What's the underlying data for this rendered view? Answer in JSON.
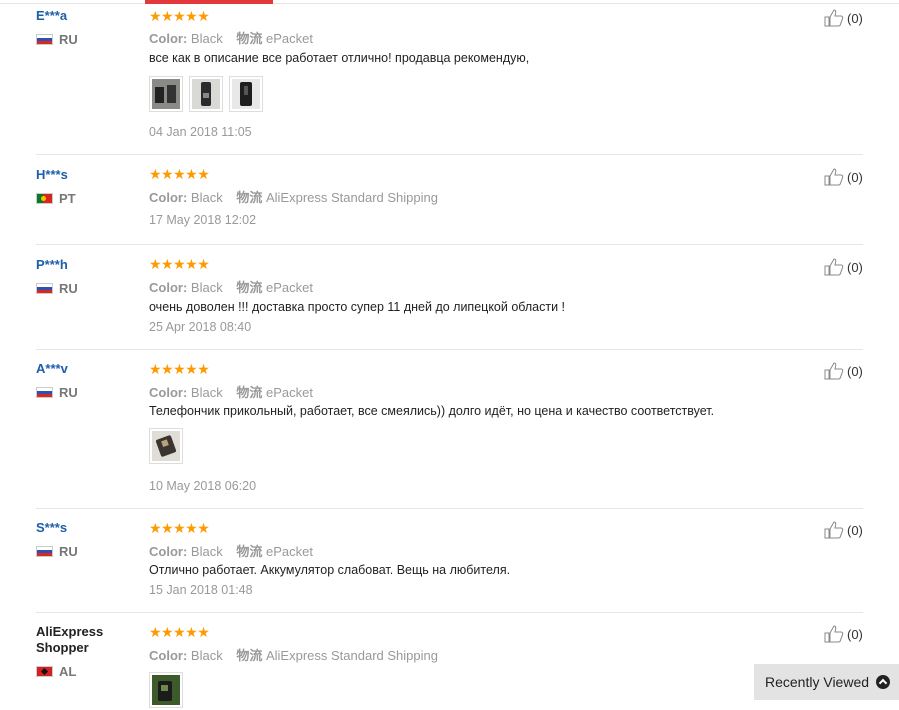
{
  "labels": {
    "color_label": "Color:",
    "shipping_label": "物流",
    "rating_stars": "★★★★★"
  },
  "reviews": [
    {
      "user": "E***a",
      "country": "RU",
      "color": "Black",
      "shipping": "ePacket",
      "text": "все как в описание все работает отлично! продавца рекомендую,",
      "photos": 3,
      "date": "04 Jan 2018 11:05",
      "helpful": "(0)"
    },
    {
      "user": "H***s",
      "country": "PT",
      "color": "Black",
      "shipping": "AliExpress Standard Shipping",
      "text": "",
      "photos": 0,
      "date": "17 May 2018 12:02",
      "helpful": "(0)"
    },
    {
      "user": "P***h",
      "country": "RU",
      "color": "Black",
      "shipping": "ePacket",
      "text": "очень доволен !!! доставка просто супер 11 дней до липецкой области !",
      "photos": 0,
      "date": "25 Apr 2018 08:40",
      "helpful": "(0)"
    },
    {
      "user": "A***v",
      "country": "RU",
      "color": "Black",
      "shipping": "ePacket",
      "text": "Телефончик прикольный, работает, все смеялись)) долго идёт, но цена и качество соответствует.",
      "photos": 1,
      "date": "10 May 2018 06:20",
      "helpful": "(0)"
    },
    {
      "user": "S***s",
      "country": "RU",
      "color": "Black",
      "shipping": "ePacket",
      "text": "Отлично работает. Аккумулятор слабоват. Вещь на любителя.",
      "photos": 0,
      "date": "15 Jan 2018 01:48",
      "helpful": "(0)"
    },
    {
      "user": "AliExpress Shopper",
      "country": "AL",
      "color": "Black",
      "shipping": "AliExpress Standard Shipping",
      "text": "",
      "photos": 1,
      "date": "",
      "helpful": "(0)"
    }
  ],
  "recently_viewed": {
    "label": "Recently Viewed",
    "icon": "chevron-up-icon"
  },
  "colors": {
    "accent": "#e4393c",
    "star": "#ff9900",
    "username": "#1c5fa8"
  }
}
